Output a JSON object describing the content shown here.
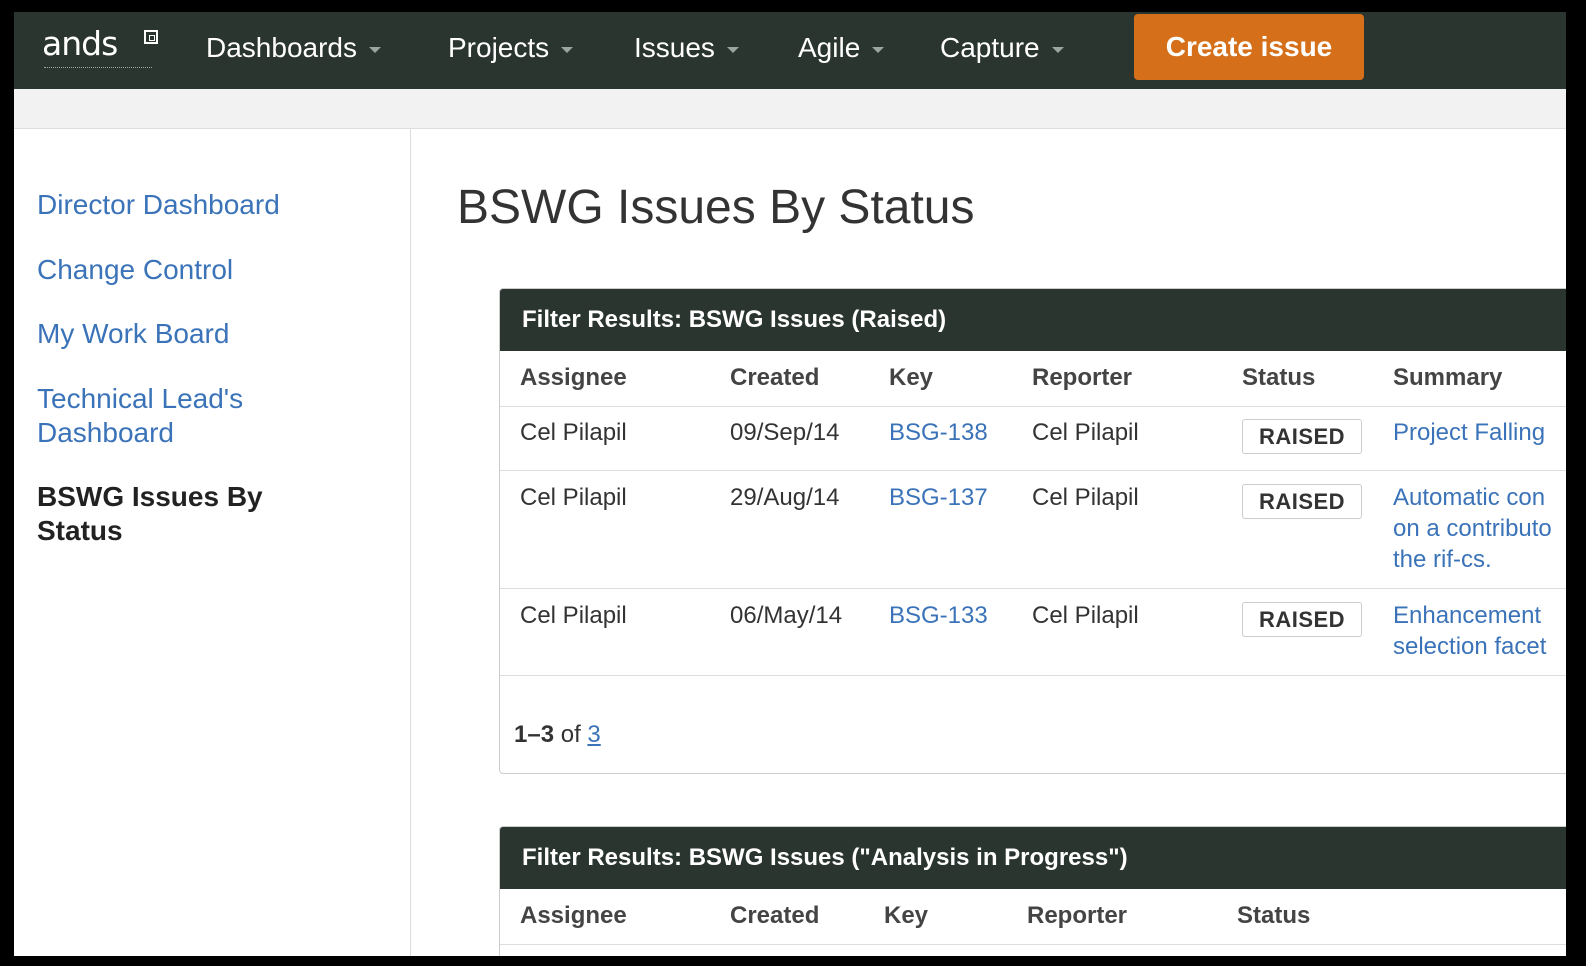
{
  "brand": {
    "logo_text": "ands"
  },
  "nav": {
    "items": [
      {
        "label": "Dashboards"
      },
      {
        "label": "Projects"
      },
      {
        "label": "Issues"
      },
      {
        "label": "Agile"
      },
      {
        "label": "Capture"
      }
    ],
    "create_label": "Create issue"
  },
  "sidebar": {
    "items": [
      {
        "label": "Director Dashboard"
      },
      {
        "label": "Change Control"
      },
      {
        "label": "My Work Board"
      },
      {
        "label": "Technical Lead's Dashboard"
      },
      {
        "label": "BSWG Issues By Status"
      }
    ]
  },
  "page": {
    "title": "BSWG Issues By Status"
  },
  "panels": [
    {
      "title": "Filter Results: BSWG Issues (Raised)",
      "columns": [
        "Assignee",
        "Created",
        "Key",
        "Reporter",
        "Status",
        "Summary"
      ],
      "rows": [
        {
          "assignee": "Cel Pilapil",
          "created": "09/Sep/14",
          "key": "BSG-138",
          "reporter": "Cel Pilapil",
          "status": "RAISED",
          "summary": "Project Falling"
        },
        {
          "assignee": "Cel Pilapil",
          "created": "29/Aug/14",
          "key": "BSG-137",
          "reporter": "Cel Pilapil",
          "status": "RAISED",
          "summary": "Automatic con on a contributo the rif-cs."
        },
        {
          "assignee": "Cel Pilapil",
          "created": "06/May/14",
          "key": "BSG-133",
          "reporter": "Cel Pilapil",
          "status": "RAISED",
          "summary": "Enhancement selection facet"
        }
      ],
      "pager": {
        "range": "1–3",
        "of": "of",
        "total": "3"
      }
    },
    {
      "title": "Filter Results: BSWG Issues (\"Analysis in Progress\")",
      "columns": [
        "Assignee",
        "Created",
        "Key",
        "Reporter",
        "Status"
      ]
    }
  ]
}
